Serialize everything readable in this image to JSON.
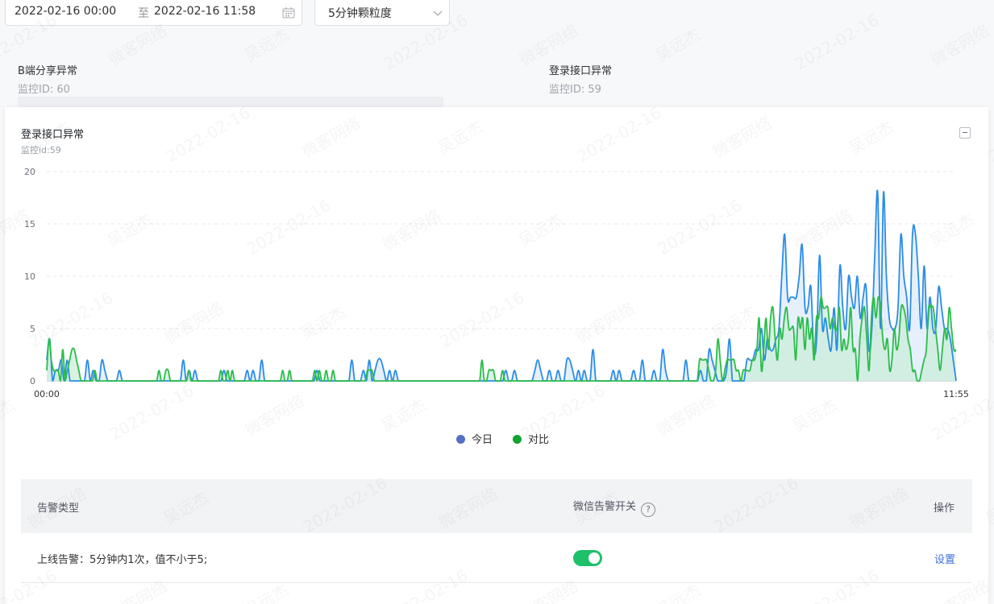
{
  "toolbar": {
    "start_time": "2022-02-16 00:00",
    "range_separator": "至",
    "end_time": "2022-02-16 11:58",
    "granularity": "5分钟颗粒度"
  },
  "background_cards": [
    {
      "title": "B端分享异常",
      "sub": "监控ID: 60"
    },
    {
      "title": "登录接口异常",
      "sub": "监控ID: 59"
    }
  ],
  "panel": {
    "title": "登录接口异常",
    "subtitle": "监控id:59"
  },
  "chart_data": {
    "type": "area",
    "title": "",
    "xlabel": "",
    "ylabel": "",
    "x_tick_labels": [
      "00:00",
      "11:55"
    ],
    "y_ticks": [
      0,
      5,
      10,
      15,
      20
    ],
    "ylim": [
      0,
      20
    ],
    "grid": "horizontal-dashed",
    "legend_position": "bottom-center",
    "series": [
      {
        "name": "今日",
        "legend_color": "#5470c6",
        "line_color": "#2b8ce8",
        "fill_color": "#ddebfb",
        "values": [
          2,
          4,
          0,
          1,
          1,
          2,
          0,
          2,
          0,
          0,
          0,
          0,
          0,
          0,
          2,
          0,
          1,
          0,
          0,
          2,
          1,
          0,
          0,
          0,
          0,
          1,
          0,
          0,
          0,
          0,
          0,
          0,
          0,
          0,
          0,
          0,
          0,
          0,
          0,
          0,
          0,
          0,
          0,
          0,
          0,
          0,
          0,
          2,
          0,
          1,
          0,
          1,
          0,
          0,
          0,
          0,
          0,
          0,
          0,
          0,
          0,
          1,
          0,
          0,
          0,
          0,
          0,
          0,
          0,
          1,
          0,
          1,
          0,
          0,
          2,
          0,
          0,
          0,
          0,
          0,
          0,
          0,
          0,
          0,
          0,
          0,
          0,
          0,
          0,
          0,
          0,
          0,
          0,
          1,
          0,
          0,
          0,
          0,
          0,
          0,
          0,
          0,
          0,
          0,
          0,
          2,
          0,
          0,
          0,
          1,
          0,
          2,
          0,
          1,
          2,
          2,
          1,
          0,
          1,
          0,
          1,
          0,
          0,
          0,
          0,
          0,
          0,
          0,
          0,
          0,
          0,
          0,
          0,
          0,
          0,
          0,
          0,
          0,
          0,
          0,
          0,
          0,
          0,
          0,
          0,
          0,
          0,
          0,
          0,
          0,
          0,
          0,
          0,
          0,
          0,
          0,
          0,
          0,
          1,
          0,
          0,
          1,
          0,
          0,
          0,
          0,
          0,
          0,
          1,
          2,
          1,
          0,
          0,
          1,
          0,
          0,
          1,
          0,
          0,
          2,
          2,
          1,
          0,
          1,
          0,
          1,
          0,
          0,
          3,
          0,
          0,
          0,
          0,
          0,
          0,
          1,
          0,
          1,
          0,
          0,
          0,
          0,
          1,
          0,
          0,
          2,
          0,
          0,
          0,
          1,
          0,
          0,
          3,
          1,
          0,
          0,
          0,
          0,
          0,
          0,
          2,
          0,
          0,
          0,
          0,
          1,
          0,
          0,
          3,
          2,
          1,
          0,
          0,
          0,
          1,
          4,
          0,
          0,
          0,
          0,
          0,
          2,
          2,
          2,
          3,
          3,
          5,
          2,
          4,
          3,
          3,
          4,
          5,
          10,
          14,
          8,
          8,
          8,
          8,
          10,
          13,
          7,
          7,
          9,
          3,
          4,
          12,
          5,
          6,
          4,
          3,
          7,
          3,
          11,
          7,
          5,
          10,
          8,
          7,
          10,
          6,
          8,
          9,
          3,
          5,
          12,
          18,
          5,
          18,
          10,
          6,
          5,
          5,
          7,
          14,
          10,
          8,
          5,
          14,
          14,
          10,
          5,
          11,
          5,
          8,
          5,
          5,
          9,
          7,
          5,
          5,
          4,
          2,
          0
        ],
        "values_note": ""
      },
      {
        "name": "对比",
        "legend_color": "#12a332",
        "line_color": "#2cbd4a",
        "fill_color": "#c9ecd7",
        "values": [
          1,
          4,
          2,
          1,
          1,
          1,
          0,
          3,
          0,
          1,
          2,
          3,
          3,
          2,
          1,
          0,
          0,
          0,
          0,
          0,
          0,
          1,
          0,
          0,
          0,
          0,
          0,
          0,
          0,
          0,
          0,
          0,
          0,
          0,
          0,
          0,
          0,
          0,
          0,
          0,
          0,
          0,
          0,
          0,
          0,
          0,
          0,
          0,
          0,
          1,
          0,
          0,
          1,
          1,
          0,
          0,
          0,
          0,
          0,
          0,
          0,
          0,
          1,
          0,
          0,
          0,
          0,
          0,
          0,
          0,
          0,
          0,
          0,
          0,
          0,
          0,
          1,
          0,
          0,
          1,
          0,
          1,
          0,
          0,
          0,
          0,
          0,
          0,
          0,
          0,
          0,
          0,
          0,
          0,
          0,
          0,
          0,
          0,
          0,
          0,
          0,
          0,
          0,
          1,
          0,
          0,
          1,
          0,
          0,
          0,
          0,
          0,
          0,
          0,
          0,
          0,
          0,
          1,
          0,
          1,
          0,
          0,
          1,
          0,
          0,
          1,
          0,
          0,
          0,
          0,
          0,
          0,
          0,
          0,
          0,
          0,
          0,
          0,
          0,
          0,
          1,
          1,
          1,
          0,
          0,
          0,
          0,
          0,
          0,
          0,
          0,
          0,
          0,
          0,
          0,
          0,
          0,
          0,
          0,
          0,
          0,
          0,
          0,
          0,
          0,
          0,
          0,
          0,
          0,
          0,
          0,
          0,
          0,
          0,
          0,
          0,
          0,
          0,
          0,
          0,
          0,
          0,
          0,
          0,
          0,
          0,
          0,
          0,
          0,
          0,
          2,
          0,
          0,
          1,
          1,
          1,
          0,
          0,
          0,
          1,
          0,
          0,
          0,
          0,
          0,
          0,
          0,
          0,
          0,
          0,
          0,
          0,
          0,
          0,
          0,
          0,
          0,
          0,
          0,
          0,
          0,
          0,
          0,
          0,
          0,
          0,
          0,
          0,
          0,
          0,
          0,
          0,
          0,
          0,
          0,
          0,
          0,
          0,
          0,
          0,
          0,
          0,
          0,
          0,
          0,
          0,
          0,
          0,
          0,
          0,
          0,
          0,
          0,
          0,
          0,
          0,
          0,
          0,
          0,
          0,
          0,
          0,
          0,
          0,
          0,
          0,
          0,
          0,
          0,
          0,
          0,
          0,
          0,
          0,
          0,
          0,
          0,
          0,
          0,
          0,
          0,
          0,
          0,
          0,
          0,
          2,
          2,
          2,
          2,
          1,
          0,
          0,
          1,
          4,
          2,
          0,
          1,
          2,
          2,
          2,
          2,
          1,
          1,
          0,
          1,
          1,
          1,
          1,
          2,
          2,
          3,
          6,
          1,
          3,
          6,
          3,
          6,
          7,
          4,
          2,
          5,
          4,
          6,
          7,
          5,
          5,
          5,
          2,
          6,
          5,
          6,
          3,
          6,
          4,
          5,
          2,
          6,
          6,
          8,
          7,
          7,
          7,
          5,
          6,
          5,
          5,
          7,
          3,
          4,
          3,
          4,
          7,
          3,
          3,
          0,
          4,
          6,
          7,
          4,
          1,
          6,
          8,
          6,
          8,
          7,
          4,
          3,
          4,
          1,
          2,
          5,
          3,
          4,
          7,
          7,
          6,
          4,
          3,
          1,
          1,
          0,
          0,
          1,
          2,
          3,
          7,
          7,
          7,
          5,
          3,
          1,
          3,
          5,
          4,
          7,
          5,
          3,
          3
        ]
      }
    ]
  },
  "table": {
    "headers": {
      "type": "告警类型",
      "wechat": "微信告警开关",
      "help": "?",
      "ops": "操作"
    },
    "rows": [
      {
        "type": "上线告警：5分钟内1次，值不小于5;",
        "wechat_enabled": true,
        "op": "设置"
      }
    ]
  },
  "watermark": {
    "texts": [
      "2022-02-16",
      "微客网络",
      "吴远杰"
    ]
  }
}
